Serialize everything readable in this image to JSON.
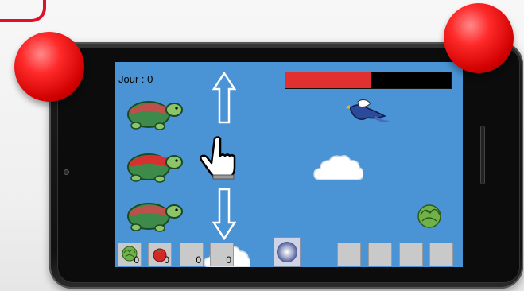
{
  "hud": {
    "day_label": "Jour  :  0",
    "health_fraction": 0.52
  },
  "colors": {
    "sky": "#4a93d4",
    "health_fill": "#e23030",
    "health_bg": "#000000",
    "joystick": "#e01c1c"
  },
  "controls": {
    "up_arrow_icon": "arrow-up-icon",
    "down_arrow_icon": "arrow-down-icon",
    "pointer_icon": "hand-pointer-icon"
  },
  "inventory": {
    "left_slots": [
      {
        "icon": "lettuce-icon",
        "count": "0"
      },
      {
        "icon": "tomato-icon",
        "count": "0"
      },
      {
        "icon": "",
        "count": "0"
      },
      {
        "icon": "",
        "count": "0"
      }
    ],
    "center_icon": "orb-icon",
    "right_slots": [
      "",
      "",
      "",
      ""
    ]
  }
}
